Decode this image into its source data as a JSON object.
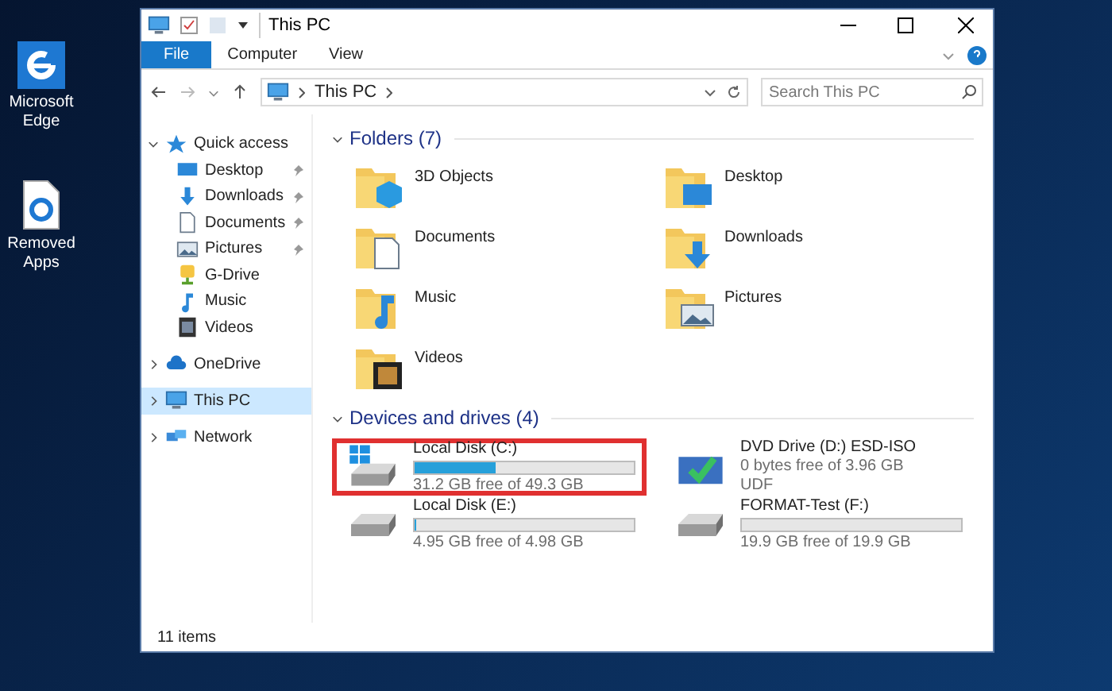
{
  "desktop_icons": [
    {
      "label": "Microsoft Edge",
      "kind": "edge"
    },
    {
      "label": "Removed Apps",
      "kind": "document"
    }
  ],
  "window": {
    "title": "This PC"
  },
  "ribbon_tabs": [
    {
      "label": "File",
      "selected": true
    },
    {
      "label": "Computer",
      "selected": false
    },
    {
      "label": "View",
      "selected": false
    }
  ],
  "address_bar": {
    "path": "This PC"
  },
  "search": {
    "placeholder": "Search This PC"
  },
  "sidebar": {
    "items": [
      {
        "label": "Quick access",
        "kind": "quick",
        "expanded": true,
        "selected": false,
        "children": [
          {
            "label": "Desktop",
            "kind": "desktop",
            "pinned": true
          },
          {
            "label": "Downloads",
            "kind": "downloads",
            "pinned": true
          },
          {
            "label": "Documents",
            "kind": "documents",
            "pinned": true
          },
          {
            "label": "Pictures",
            "kind": "pictures",
            "pinned": true
          },
          {
            "label": "G-Drive",
            "kind": "gdrive",
            "pinned": false
          },
          {
            "label": "Music",
            "kind": "music",
            "pinned": false
          },
          {
            "label": "Videos",
            "kind": "videos",
            "pinned": false
          }
        ]
      },
      {
        "label": "OneDrive",
        "kind": "onedrive",
        "expanded": false,
        "selected": false
      },
      {
        "label": "This PC",
        "kind": "pc",
        "expanded": false,
        "selected": true
      },
      {
        "label": "Network",
        "kind": "network",
        "expanded": false,
        "selected": false
      }
    ]
  },
  "folders": {
    "heading": "Folders (7)",
    "items": [
      {
        "label": "3D Objects",
        "kind": "objects"
      },
      {
        "label": "Desktop",
        "kind": "desktop"
      },
      {
        "label": "Documents",
        "kind": "documents"
      },
      {
        "label": "Downloads",
        "kind": "downloads"
      },
      {
        "label": "Music",
        "kind": "music"
      },
      {
        "label": "Pictures",
        "kind": "pictures"
      },
      {
        "label": "Videos",
        "kind": "videos"
      }
    ]
  },
  "drives": {
    "heading": "Devices and drives (4)",
    "items": [
      {
        "label": "Local Disk (C:)",
        "kind": "system",
        "level": 0.37,
        "free": "31.2 GB free of 49.3 GB",
        "highlighted": true
      },
      {
        "label": "DVD Drive (D:) ESD-ISO",
        "kind": "dvd",
        "free": "0 bytes free of 3.96 GB",
        "filesystem": "UDF",
        "highlighted": false
      },
      {
        "label": "Local Disk (E:)",
        "kind": "disk",
        "level": 0.01,
        "free": "4.95 GB free of 4.98 GB",
        "highlighted": false
      },
      {
        "label": "FORMAT-Test (F:)",
        "kind": "disk",
        "free": "19.9 GB free of 19.9 GB",
        "highlighted": false
      }
    ]
  },
  "status_bar": {
    "count": "11 items"
  }
}
